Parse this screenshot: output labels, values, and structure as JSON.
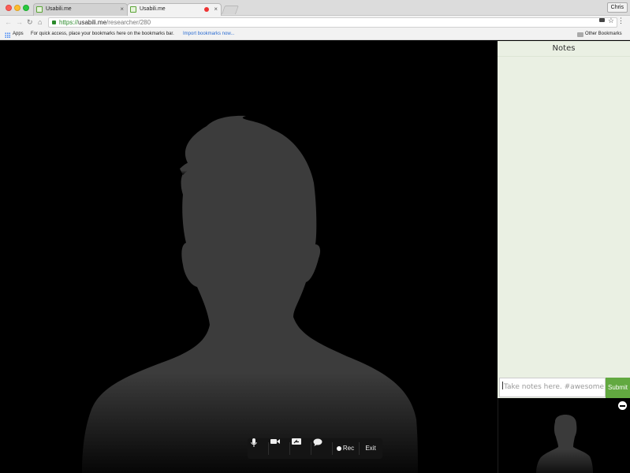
{
  "browser": {
    "tabs": [
      {
        "title": "Usabili.me",
        "active": false,
        "recording": false
      },
      {
        "title": "Usabili.me",
        "active": true,
        "recording": true
      }
    ],
    "profile_name": "Chris",
    "url": {
      "scheme": "https://",
      "host": "usabili.me",
      "path": "/researcher/280"
    },
    "bookmarks_bar": {
      "apps_label": "Apps",
      "hint": "For quick access, place your bookmarks here on the bookmarks bar.",
      "import_link": "Import bookmarks now...",
      "other_bookmarks": "Other Bookmarks"
    }
  },
  "call_controls": {
    "mic_icon": "microphone-icon",
    "camera_icon": "video-camera-icon",
    "screen_share_icon": "screen-share-icon",
    "chat_icon": "chat-bubble-icon",
    "rec_label": "Rec",
    "exit_label": "Exit"
  },
  "notes": {
    "title": "Notes",
    "placeholder": "Take notes here. #awesome",
    "submit_label": "Submit"
  },
  "colors": {
    "accent_green": "#62a940",
    "notes_bg": "#eaf0e3",
    "silhouette": "#3c3c3c"
  }
}
